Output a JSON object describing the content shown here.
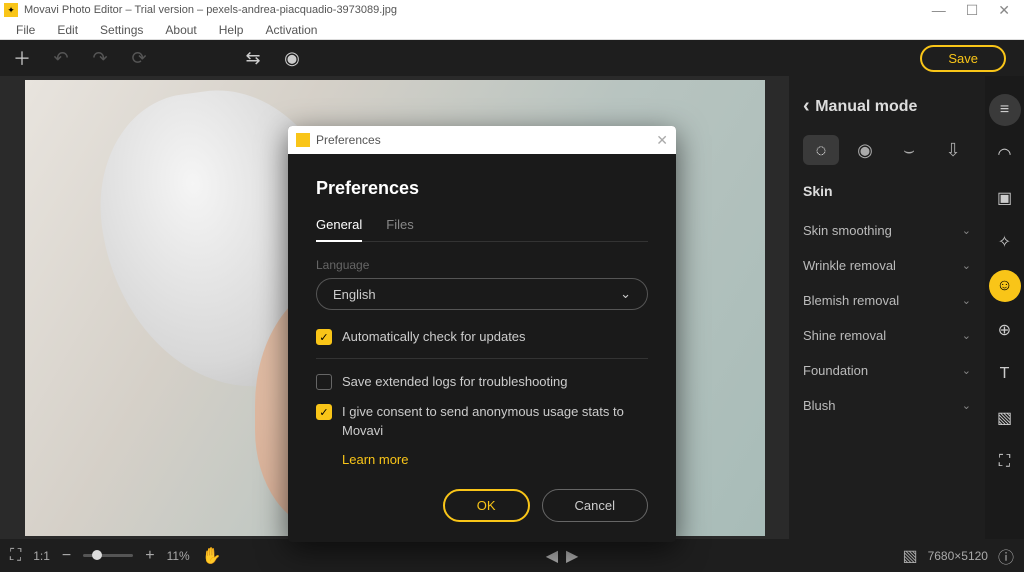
{
  "titlebar": {
    "text": "Movavi Photo Editor – Trial version – pexels-andrea-piacquadio-3973089.jpg"
  },
  "menubar": {
    "file": "File",
    "edit": "Edit",
    "settings": "Settings",
    "about": "About",
    "help": "Help",
    "activation": "Activation"
  },
  "toolbar": {
    "save": "Save"
  },
  "sidebar": {
    "mode_title": "Manual mode",
    "section": "Skin",
    "items": [
      "Skin smoothing",
      "Wrinkle removal",
      "Blemish removal",
      "Shine removal",
      "Foundation",
      "Blush"
    ]
  },
  "bottombar": {
    "ratio": "1:1",
    "zoom": "11%",
    "dimensions": "7680×5120"
  },
  "dialog": {
    "title": "Preferences",
    "heading": "Preferences",
    "tabs": {
      "general": "General",
      "files": "Files"
    },
    "language_label": "Language",
    "language_value": "English",
    "check_updates": "Automatically check for updates",
    "save_logs": "Save extended logs for troubleshooting",
    "consent": "I give consent to send anonymous usage stats to Movavi",
    "learn_more": "Learn more",
    "ok": "OK",
    "cancel": "Cancel"
  }
}
